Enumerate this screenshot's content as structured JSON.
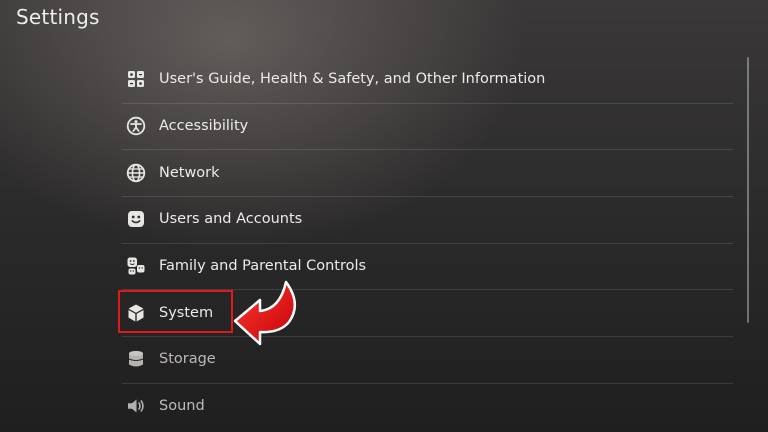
{
  "header": {
    "title": "Settings"
  },
  "menu": {
    "items": [
      {
        "label": "User's Guide, Health & Safety, and Other Information",
        "icon": "info-guide-icon"
      },
      {
        "label": "Accessibility",
        "icon": "accessibility-icon"
      },
      {
        "label": "Network",
        "icon": "globe-icon"
      },
      {
        "label": "Users and Accounts",
        "icon": "user-face-icon"
      },
      {
        "label": "Family and Parental Controls",
        "icon": "family-icon"
      },
      {
        "label": "System",
        "icon": "cube-icon"
      },
      {
        "label": "Storage",
        "icon": "database-icon"
      },
      {
        "label": "Sound",
        "icon": "speaker-icon"
      }
    ],
    "selected": "System"
  },
  "annotation": {
    "highlight_color": "#e0191b",
    "arrow_color": "#e0191b"
  }
}
